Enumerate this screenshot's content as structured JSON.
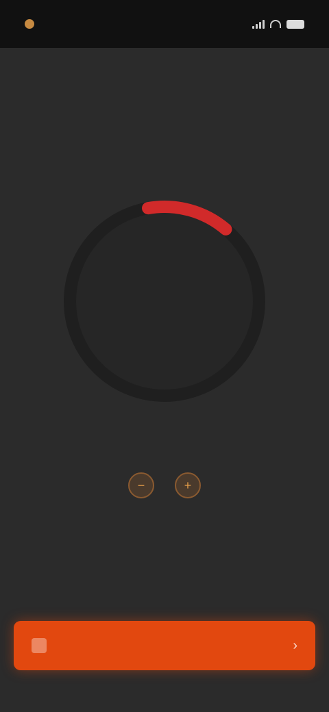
{
  "status_bar": {
    "time": "",
    "icons": [
      "status-dot-icon",
      "signal-icon",
      "wifi-icon",
      "battery-icon"
    ]
  },
  "header": {
    "subtitle": "",
    "title": ""
  },
  "dial": {
    "value": "",
    "label": "",
    "arc_fraction": 0.14,
    "track_color": "#1f1f1f",
    "arc_color": "#d12a2a"
  },
  "round_buttons": [
    {
      "icon": "decrease-icon",
      "glyph": "−"
    },
    {
      "icon": "increase-icon",
      "glyph": "+"
    }
  ],
  "info_text": "",
  "small_link": "",
  "primary_button": {
    "label": "",
    "icon": "action-icon",
    "chevron": "›",
    "color": "#e2480f"
  },
  "colors": {
    "background": "#2b2b2b",
    "status_bar": "#111111",
    "accent": "#e2480f"
  }
}
